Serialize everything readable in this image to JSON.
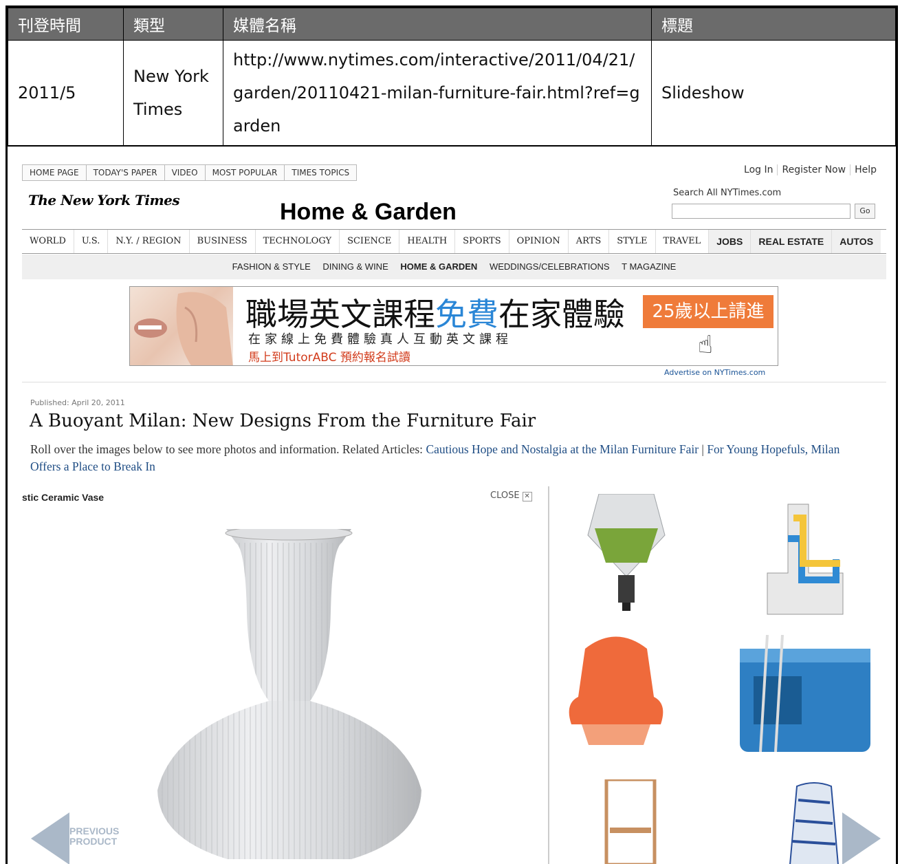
{
  "meta_table": {
    "headers": [
      "刊登時間",
      "類型",
      "媒體名稱",
      "標題"
    ],
    "row": {
      "date": "2011/5",
      "type": "New York Times",
      "url": "http://www.nytimes.com/interactive/2011/04/21/garden/20110421-milan-furniture-fair.html?ref=garden",
      "title": "Slideshow"
    }
  },
  "screenshot": {
    "top_tabs": [
      "HOME PAGE",
      "TODAY'S PAPER",
      "VIDEO",
      "MOST POPULAR",
      "TIMES TOPICS"
    ],
    "top_links": [
      "Log In",
      "Register Now",
      "Help"
    ],
    "logo": "The New York Times",
    "section_title": "Home & Garden",
    "search_label": "Search All NYTimes.com",
    "search_go": "Go",
    "nav_serif": [
      "WORLD",
      "U.S.",
      "N.Y. / REGION",
      "BUSINESS",
      "TECHNOLOGY",
      "SCIENCE",
      "HEALTH",
      "SPORTS",
      "OPINION",
      "ARTS",
      "STYLE",
      "TRAVEL"
    ],
    "nav_sans": [
      "JOBS",
      "REAL ESTATE",
      "AUTOS"
    ],
    "subnav": [
      "FASHION & STYLE",
      "DINING & WINE",
      "HOME & GARDEN",
      "WEDDINGS/CELEBRATIONS",
      "T MAGAZINE"
    ],
    "subnav_current": "HOME & GARDEN",
    "ad": {
      "headline_a": "職場英文課程",
      "headline_b": "免費",
      "headline_c": "在家體驗",
      "line2": "在家線上免費體驗真人互動英文課程",
      "line3": "馬上到TutorABC 預約報名試讀",
      "button": "25歲以上請進"
    },
    "advertise": "Advertise on NYTimes.com",
    "published": "Published: April 20, 2011",
    "headline": "A Buoyant Milan: New Designs From the Furniture Fair",
    "deck_text": "Roll over the images below to see more photos and information. Related Articles: ",
    "link1": "Cautious Hope and Nostalgia at the Milan Furniture Fair",
    "separator": " | ",
    "link2": "For Young Hopefuls, Milan Offers a Place to Break In",
    "slide_caption": "stic Ceramic Vase",
    "close": "CLOSE",
    "close_x": "✕",
    "previous_1": "PREVIOUS",
    "previous_2": "PRODUCT",
    "colors": {
      "link_blue": "#1f4d84",
      "ad_orange": "#ef7b3a",
      "ad_blue": "#2a86d6"
    }
  }
}
